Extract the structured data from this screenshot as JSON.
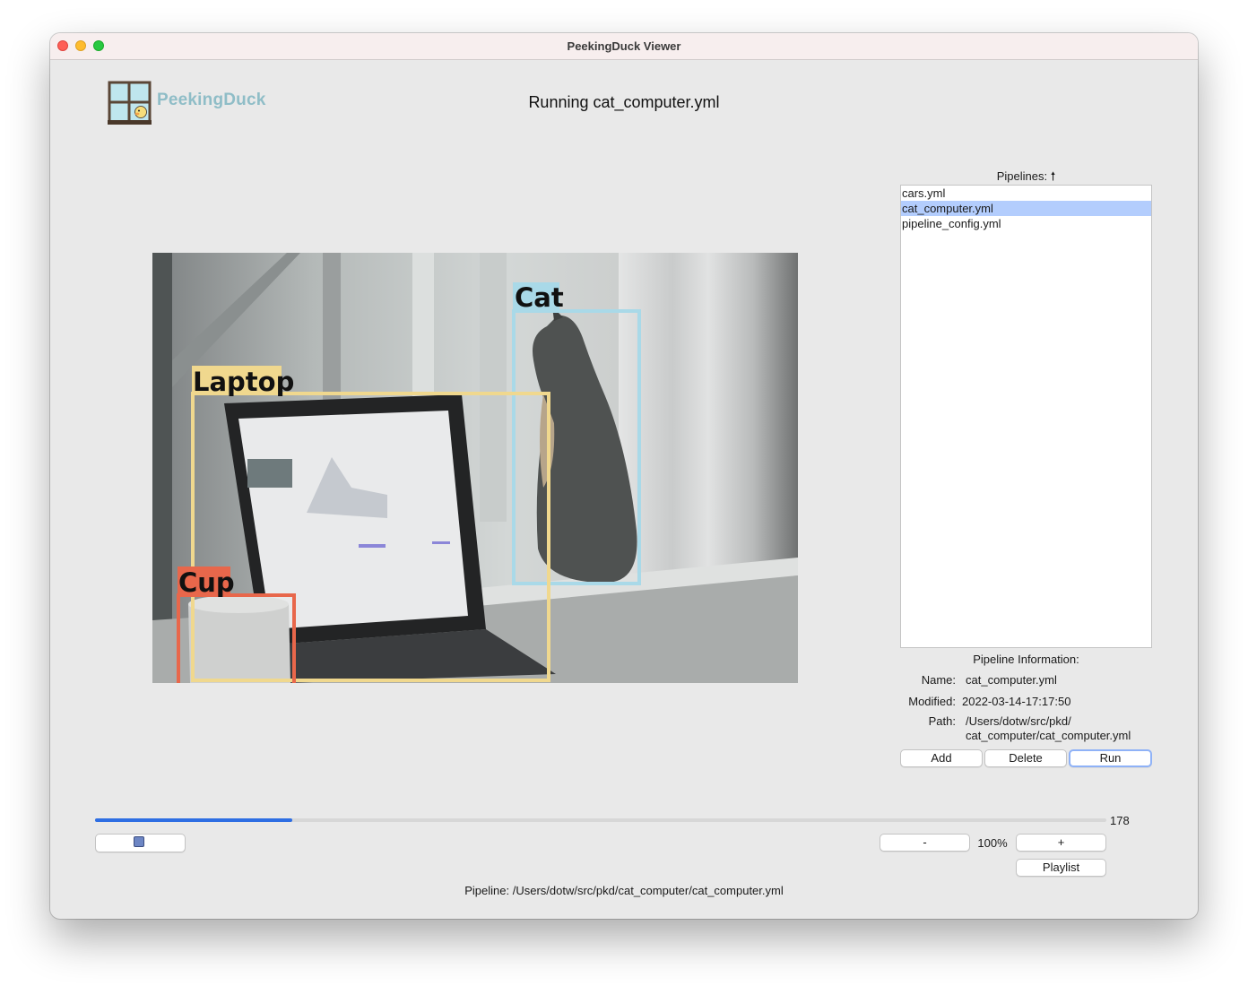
{
  "window": {
    "title": "PeekingDuck Viewer"
  },
  "header": {
    "logo_text": "PeekingDuck",
    "running_text": "Running cat_computer.yml"
  },
  "video": {
    "detections": [
      {
        "label": "Cat",
        "color": "#a9d9e8"
      },
      {
        "label": "Laptop",
        "color": "#f0d88e"
      },
      {
        "label": "Cup",
        "color": "#e8674b"
      }
    ]
  },
  "pipelines": {
    "label": "Pipelines: 🠕",
    "items": [
      "cars.yml",
      "cat_computer.yml",
      "pipeline_config.yml"
    ],
    "selected_index": 1
  },
  "info": {
    "title": "Pipeline Information:",
    "name_key": "Name:",
    "name_value": "cat_computer.yml",
    "modified_key": "Modified:",
    "modified_value": "2022-03-14-17:17:50",
    "path_key": "Path:",
    "path_line1": "/Users/dotw/src/pkd/",
    "path_line2": "cat_computer/cat_computer.yml"
  },
  "buttons": {
    "add": "Add",
    "delete": "Delete",
    "run": "Run"
  },
  "playback": {
    "frame_count": "178",
    "progress_fraction": 0.195,
    "zoom_minus": "-",
    "zoom_level": "100%",
    "zoom_plus": "+",
    "playlist": "Playlist",
    "accent_color": "#2e6ee3"
  },
  "status": {
    "pipeline_text": "Pipeline: /Users/dotw/src/pkd/cat_computer/cat_computer.yml"
  }
}
